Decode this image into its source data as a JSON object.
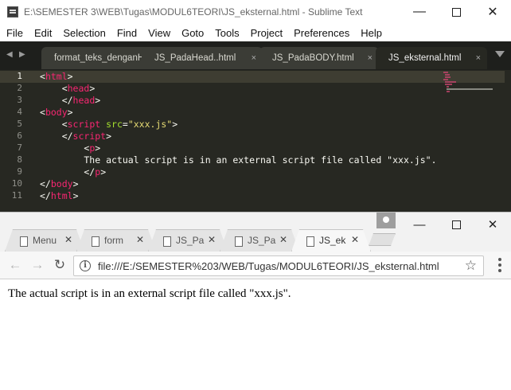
{
  "sublime": {
    "title": "E:\\SEMESTER 3\\WEB\\Tugas\\MODUL6TEORI\\JS_eksternal.html - Sublime Text",
    "menu": [
      "File",
      "Edit",
      "Selection",
      "Find",
      "View",
      "Goto",
      "Tools",
      "Project",
      "Preferences",
      "Help"
    ],
    "tabs": [
      {
        "label": "format_teks_denganH",
        "close": ""
      },
      {
        "label": "JS_PadaHead..html",
        "close": "×"
      },
      {
        "label": "JS_PadaBODY.html",
        "close": "×"
      },
      {
        "label": "JS_eksternal.html",
        "close": "×"
      }
    ],
    "active_tab": 3,
    "line_numbers": [
      "1",
      "2",
      "3",
      "4",
      "5",
      "6",
      "7",
      "8",
      "9",
      "10",
      "11"
    ],
    "current_line": 1,
    "code_lines": [
      [
        {
          "c": "p",
          "t": "<"
        },
        {
          "c": "t",
          "t": "html"
        },
        {
          "c": "p",
          "t": ">"
        }
      ],
      [
        {
          "c": "p",
          "t": "    <"
        },
        {
          "c": "t",
          "t": "head"
        },
        {
          "c": "p",
          "t": ">"
        }
      ],
      [
        {
          "c": "p",
          "t": "    </"
        },
        {
          "c": "t",
          "t": "head"
        },
        {
          "c": "p",
          "t": ">"
        }
      ],
      [
        {
          "c": "p",
          "t": "<"
        },
        {
          "c": "t",
          "t": "body"
        },
        {
          "c": "p",
          "t": ">"
        }
      ],
      [
        {
          "c": "p",
          "t": "    <"
        },
        {
          "c": "t",
          "t": "script"
        },
        {
          "c": "p",
          "t": " "
        },
        {
          "c": "a",
          "t": "src"
        },
        {
          "c": "p",
          "t": "="
        },
        {
          "c": "s",
          "t": "\"xxx.js\""
        },
        {
          "c": "p",
          "t": ">"
        }
      ],
      [
        {
          "c": "p",
          "t": "    </"
        },
        {
          "c": "t",
          "t": "script"
        },
        {
          "c": "p",
          "t": ">"
        }
      ],
      [
        {
          "c": "p",
          "t": "        <"
        },
        {
          "c": "t",
          "t": "p"
        },
        {
          "c": "p",
          "t": ">"
        }
      ],
      [
        {
          "c": "p",
          "t": "        The actual script is in an external script file called \"xxx.js\"."
        }
      ],
      [
        {
          "c": "p",
          "t": "        </"
        },
        {
          "c": "t",
          "t": "p"
        },
        {
          "c": "p",
          "t": ">"
        }
      ],
      [
        {
          "c": "p",
          "t": "</"
        },
        {
          "c": "t",
          "t": "body"
        },
        {
          "c": "p",
          "t": ">"
        }
      ],
      [
        {
          "c": "p",
          "t": "</"
        },
        {
          "c": "t",
          "t": "html"
        },
        {
          "c": "p",
          "t": ">"
        }
      ]
    ]
  },
  "chrome": {
    "tabs": [
      {
        "label": "Menu"
      },
      {
        "label": "form"
      },
      {
        "label": "JS_Pa"
      },
      {
        "label": "JS_Pa"
      },
      {
        "label": "JS_ek"
      }
    ],
    "active_tab": 4,
    "url": "file:///E:/SEMESTER%203/WEB/Tugas/MODUL6TEORI/JS_eksternal.html",
    "page_text": "The actual script is in an external script file called \"xxx.js\"."
  },
  "colors": {
    "editor_bg": "#272822",
    "tag": "#f92672",
    "attr": "#a6e22e",
    "string": "#e6db74",
    "text": "#f8f8f2"
  },
  "icons": {
    "window_minimize": "minimize-icon",
    "window_maximize": "maximize-icon",
    "window_close": "close-icon",
    "back": "arrow-left-icon",
    "forward": "arrow-right-icon",
    "reload": "reload-icon",
    "info": "info-icon",
    "bookmark": "star-icon",
    "menu": "more-vert-icon"
  }
}
